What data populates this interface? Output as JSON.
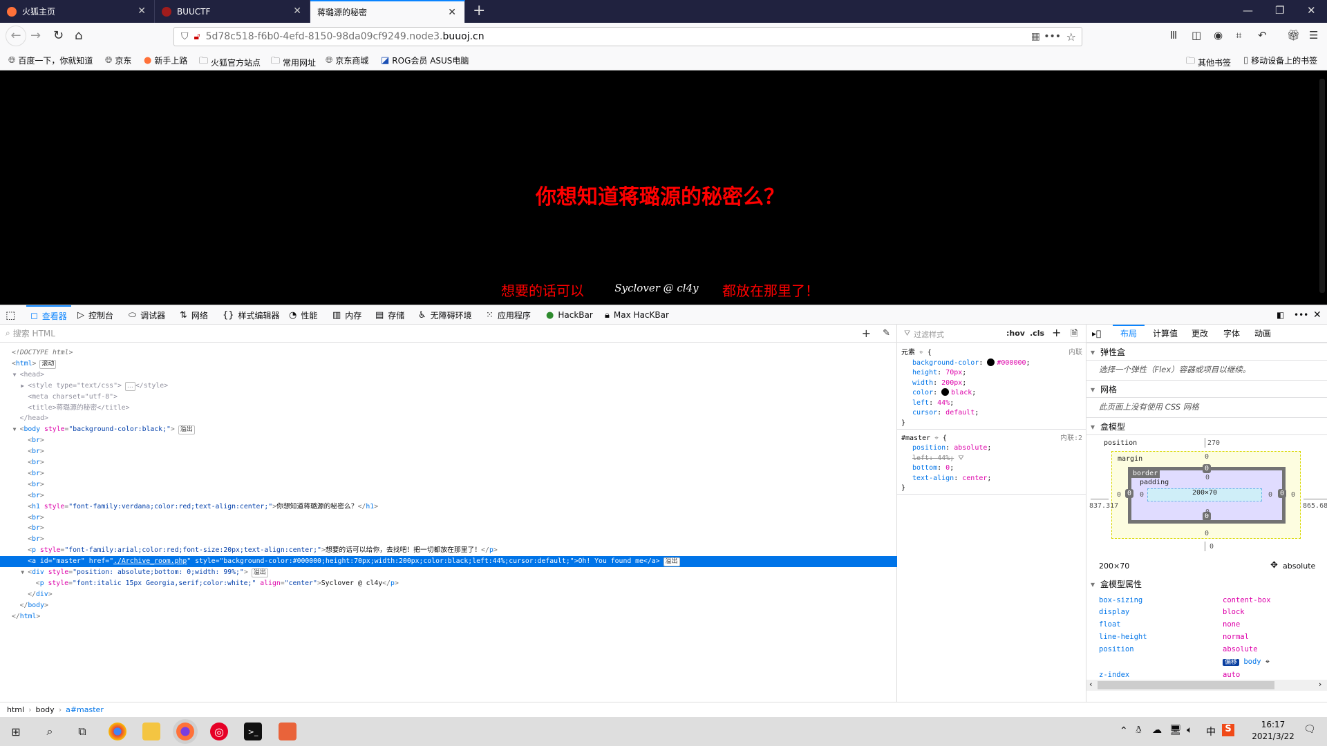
{
  "browser": {
    "tabs": [
      {
        "label": "火狐主页",
        "icon": "firefox-icon",
        "color": "#ff7139"
      },
      {
        "label": "BUUCTF",
        "icon": "buuctf-icon",
        "color": "#a01c1c"
      },
      {
        "label": "蒋璐源的秘密",
        "icon": "",
        "color": "",
        "active": true
      }
    ],
    "url_prefix": "5d78c518-f6b0-4efd-8150-98da09cf9249.node3.",
    "url_host": "buuoj.cn",
    "bookmarks": [
      {
        "label": "百度一下，你就知道",
        "icon": "globe-icon"
      },
      {
        "label": "京东",
        "icon": "globe-icon"
      },
      {
        "label": "新手上路",
        "icon": "firefox-icon"
      },
      {
        "label": "火狐官方站点",
        "icon": "folder-icon"
      },
      {
        "label": "常用网址",
        "icon": "folder-icon"
      },
      {
        "label": "京东商城",
        "icon": "globe-icon"
      },
      {
        "label": "ROG会员 ASUS电脑",
        "icon": "asus-icon"
      }
    ],
    "bookmarks_right": [
      {
        "label": "其他书签",
        "icon": "folder-icon"
      },
      {
        "label": "移动设备上的书签",
        "icon": "mobile-icon"
      }
    ]
  },
  "page": {
    "heading": "你想知道蒋璐源的秘密么？",
    "paragraph": "想要的话可以给你，去找吧！把一切都放在那里了！",
    "link_text": "Oh! You found me",
    "signature": "Syclover @ cl4y",
    "heading_color": "#ff0000"
  },
  "devtools": {
    "tabs": [
      {
        "label": "查看器",
        "icon": "inspector-icon",
        "active": true
      },
      {
        "label": "控制台",
        "icon": "console-icon"
      },
      {
        "label": "调试器",
        "icon": "debugger-icon"
      },
      {
        "label": "网络",
        "icon": "network-icon"
      },
      {
        "label": "样式编辑器",
        "icon": "style-editor-icon"
      },
      {
        "label": "性能",
        "icon": "performance-icon"
      },
      {
        "label": "内存",
        "icon": "memory-icon"
      },
      {
        "label": "存储",
        "icon": "storage-icon"
      },
      {
        "label": "无障碍环境",
        "icon": "accessibility-icon"
      },
      {
        "label": "应用程序",
        "icon": "application-icon"
      },
      {
        "label": "HackBar",
        "icon": "hackbar-icon"
      },
      {
        "label": "Max HacKBar",
        "icon": "max-hackbar-icon"
      }
    ],
    "search_placeholder": "搜索 HTML",
    "markup": [
      {
        "depth": 0,
        "text": "<!DOCTYPE html>",
        "doctype": true
      },
      {
        "depth": 0,
        "text": "<html>",
        "badge": "滚动"
      },
      {
        "depth": 1,
        "text": "<head>",
        "toggle": "open",
        "dim": true
      },
      {
        "depth": 2,
        "text": "<style type=\"text/css\">",
        "toggle": "closed",
        "dim": true,
        "ellipsis": true,
        "after": "</style>"
      },
      {
        "depth": 2,
        "text": "<meta charset=\"utf-8\">",
        "dim": true
      },
      {
        "depth": 2,
        "text": "<title>蒋璐源的秘密</title>",
        "dim": true
      },
      {
        "depth": 1,
        "text": "</head>",
        "dim": true
      },
      {
        "depth": 1,
        "text": "<body style=\"background-color:black;\">",
        "toggle": "open",
        "badge": "溢出"
      },
      {
        "depth": 2,
        "text": "<br>"
      },
      {
        "depth": 2,
        "text": "<br>"
      },
      {
        "depth": 2,
        "text": "<br>"
      },
      {
        "depth": 2,
        "text": "<br>"
      },
      {
        "depth": 2,
        "text": "<br>"
      },
      {
        "depth": 2,
        "text": "<br>"
      },
      {
        "depth": 2,
        "text": "<h1 style=\"font-family:verdana;color:red;text-align:center;\">你想知道蒋璐源的秘密么？</h1>"
      },
      {
        "depth": 2,
        "text": "<br>"
      },
      {
        "depth": 2,
        "text": "<br>"
      },
      {
        "depth": 2,
        "text": "<br>"
      },
      {
        "depth": 2,
        "text": "<p style=\"font-family:arial;color:red;font-size:20px;text-align:center;\">想要的话可以给你，去找吧！把一切都放在那里了！</p>"
      },
      {
        "depth": 2,
        "text": "<a id=\"master\" href=\"./Archive_room.php\" style=\"background-color:#000000;height:70px;width:200px;color:black;left:44%;cursor:default;\">Oh! You found me</a>",
        "badge": "溢出",
        "selected": true
      },
      {
        "depth": 2,
        "text": "<div style=\"position: absolute;bottom: 0;width: 99%;\">",
        "toggle": "open",
        "badge": "溢出"
      },
      {
        "depth": 3,
        "text": "<p style=\"font:italic 15px Georgia,serif;color:white;\" align=\"center\">Syclover @ cl4y</p>"
      },
      {
        "depth": 2,
        "text": "</div>"
      },
      {
        "depth": 1,
        "text": "</body>"
      },
      {
        "depth": 0,
        "text": "</html>"
      }
    ],
    "rules_filter_placeholder": "过滤样式",
    "rules_buttons": [
      ":hov",
      ".cls"
    ],
    "rules": [
      {
        "selector": "元素",
        "source": "内联",
        "decls": [
          {
            "name": "background-color",
            "value": "#000000",
            "swatch": "#000000"
          },
          {
            "name": "height",
            "value": "70px"
          },
          {
            "name": "width",
            "value": "200px"
          },
          {
            "name": "color",
            "value": "black",
            "swatch": "#000000"
          },
          {
            "name": "left",
            "value": "44%"
          },
          {
            "name": "cursor",
            "value": "default"
          }
        ]
      },
      {
        "selector": "#master",
        "source": "内联:2",
        "decls": [
          {
            "name": "position",
            "value": "absolute"
          },
          {
            "name": "left",
            "value": "44%",
            "overridden": true
          },
          {
            "name": "bottom",
            "value": "0"
          },
          {
            "name": "text-align",
            "value": "center"
          }
        ]
      }
    ],
    "layout_tabs": [
      "布局",
      "计算值",
      "更改",
      "字体",
      "动画"
    ],
    "flexbox": {
      "title": "弹性盒",
      "message": "选择一个弹性（Flex）容器或项目以继续。"
    },
    "grid": {
      "title": "网格",
      "message": "此页面上没有使用 CSS 网格"
    },
    "boxmodel": {
      "title": "盒模型",
      "position_label": "position",
      "top": "270",
      "left": "837.317",
      "right": "865.683",
      "bottom": "0",
      "margin_label": "margin",
      "border_label": "border",
      "padding_label": "padding",
      "margin": "0",
      "border": "0",
      "padding": "0",
      "content": "200×70",
      "size": "200×70",
      "position_value": "absolute"
    },
    "boxprops": {
      "title": "盒模型属性",
      "items": [
        {
          "name": "box-sizing",
          "value": "content-box"
        },
        {
          "name": "display",
          "value": "block"
        },
        {
          "name": "float",
          "value": "none"
        },
        {
          "name": "line-height",
          "value": "normal"
        },
        {
          "name": "position",
          "value": "absolute"
        },
        {
          "name": "",
          "value": "body",
          "badge": "偏移"
        },
        {
          "name": "z-index",
          "value": "auto"
        }
      ]
    },
    "breadcrumbs": [
      "html",
      "body",
      "a#master"
    ]
  },
  "taskbar": {
    "time": "16:17",
    "date": "2021/3/22",
    "tray_ime": "中"
  }
}
